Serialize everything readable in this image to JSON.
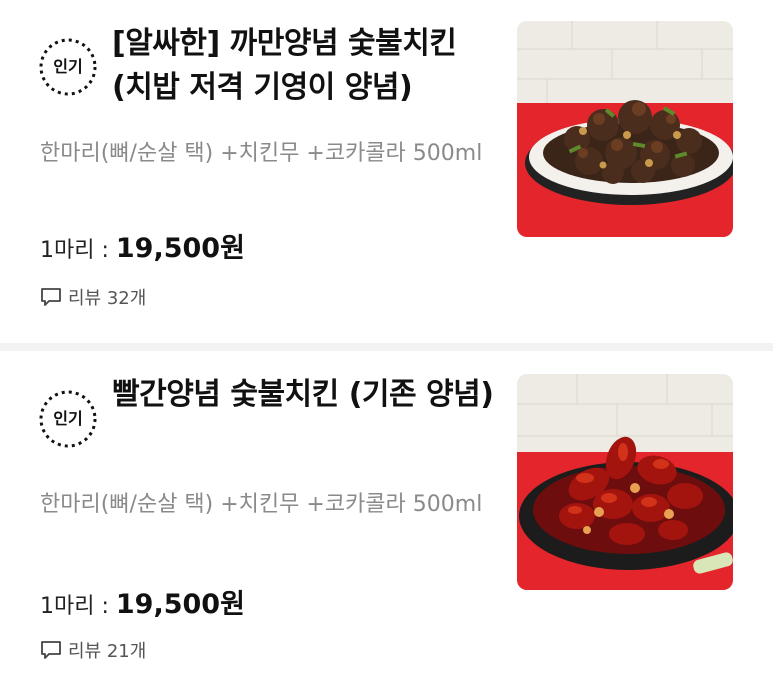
{
  "menu": {
    "items": [
      {
        "badge": "인기",
        "title": "[알싸한] 까만양념 숯불치킨 (치밥 저격 기영이 양념)",
        "description": "한마리(뼈/순살 택) +치킨무 +코카콜라 500ml",
        "price_label": "1마리 : ",
        "price": "19,500원",
        "review_text": "리뷰 32개",
        "image_icon": "black-sauce-chicken-photo"
      },
      {
        "badge": "인기",
        "title": "빨간양념 숯불치킨 (기존 양념)",
        "description": "한마리(뼈/순살 택) +치킨무 +코카콜라 500ml",
        "price_label": "1마리 : ",
        "price": "19,500원",
        "review_text": "리뷰 21개",
        "image_icon": "red-sauce-chicken-photo"
      }
    ]
  },
  "colors": {
    "background": "#ffffff",
    "separator": "#f2f2f2",
    "description": "#8a8a8a",
    "tile_wall": "#eeeae4",
    "counter_red": "#e4262c"
  }
}
